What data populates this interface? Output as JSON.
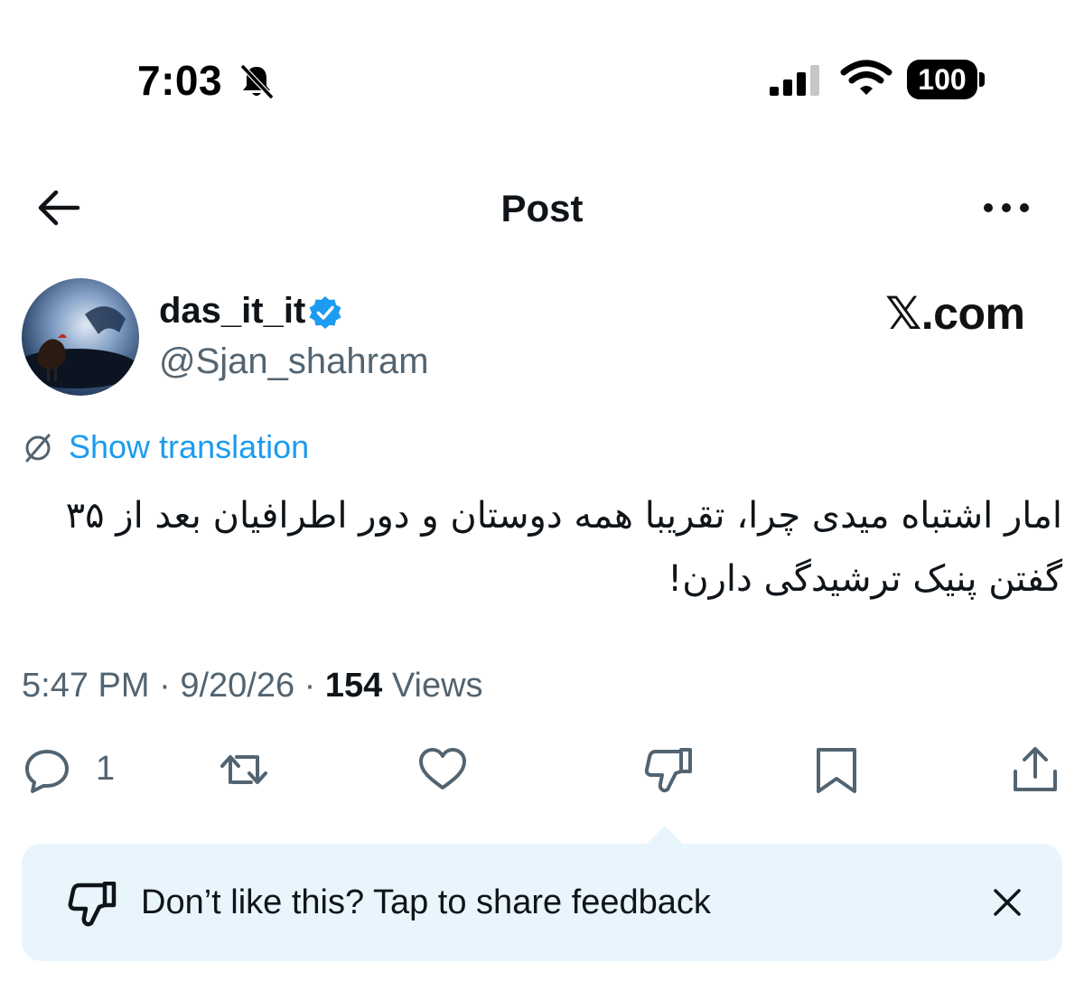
{
  "status_bar": {
    "time": "7:03",
    "battery": "100"
  },
  "nav": {
    "title": "Post"
  },
  "author": {
    "display_name": "das_it_it",
    "handle": "@Sjan_shahram",
    "verified": true
  },
  "watermark": "𝕏.com",
  "translation_link": "Show translation",
  "post": {
    "text": "امار اشتباه میدی چرا، تقریبا همه دوستان و دور اطرافیان بعد از ۳۵ گفتن پنیک ترشیدگی دارن!"
  },
  "meta": {
    "time": "5:47 PM",
    "separator": " · ",
    "date": "9/20/26",
    "views_count": "154",
    "views_label": " Views"
  },
  "actions": {
    "reply_count": "1"
  },
  "feedback_banner": {
    "text": "Don’t like this? Tap to share feedback"
  },
  "colors": {
    "accent": "#1d9bf0",
    "secondary_text": "#536471",
    "banner_bg": "#e8f5fd",
    "icon": "#536471"
  },
  "icons": [
    "bell-slash-icon",
    "cellular-signal-icon",
    "wifi-icon",
    "battery-icon",
    "back-arrow-icon",
    "more-icon",
    "verified-badge-icon",
    "translate-icon",
    "reply-icon",
    "repost-icon",
    "like-icon",
    "dislike-icon",
    "bookmark-icon",
    "share-icon",
    "close-icon"
  ]
}
